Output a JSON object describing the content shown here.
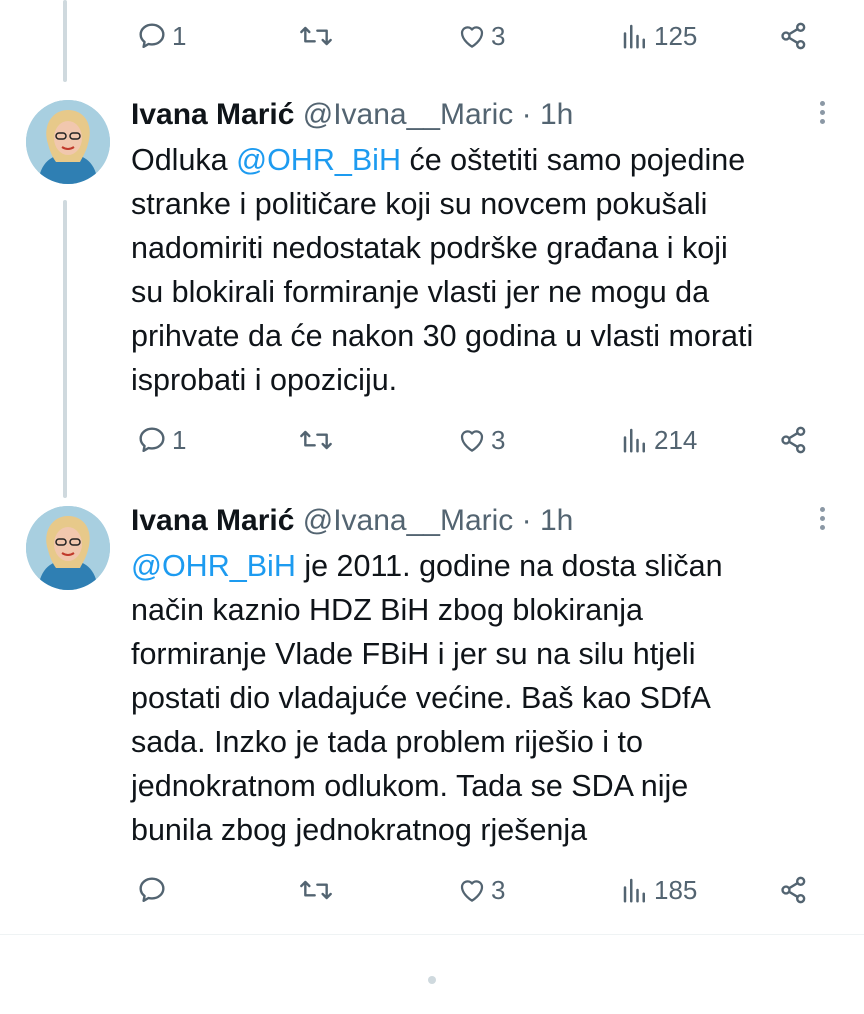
{
  "top_actions": {
    "replies": "1",
    "likes": "3",
    "views": "125"
  },
  "tweets": [
    {
      "name": "Ivana Marić",
      "handle": "@Ivana__Maric",
      "dot": "·",
      "time": "1h",
      "lines": [
        {
          "mention": "",
          "pre": "Odluka ",
          "mention_text": "@OHR_BiH",
          "post": " će oštetiti samo pojedine"
        },
        {
          "pre": "stranke i političare koji su novcem pokušali"
        },
        {
          "pre": "nadomiriti nedostatak podrške građana i koji"
        },
        {
          "pre": "su blokirali formiranje vlasti jer ne mogu da"
        },
        {
          "pre": "prihvate da će nakon 30 godina u vlasti morati"
        },
        {
          "pre": "isprobati i opoziciju."
        }
      ],
      "replies": "1",
      "likes": "3",
      "views": "214"
    },
    {
      "name": "Ivana Marić",
      "handle": "@Ivana__Maric",
      "dot": "·",
      "time": "1h",
      "lines": [
        {
          "mention_text": "@OHR_BiH",
          "post": " je 2011. godine na dosta sličan"
        },
        {
          "pre": "način kaznio HDZ BiH zbog blokiranja"
        },
        {
          "pre": "formiranje Vlade FBiH i jer su na silu htjeli"
        },
        {
          "pre": "postati dio vladajuće većine. Baš kao SDfA"
        },
        {
          "pre": "sada. Inzko je tada problem riješio i to"
        },
        {
          "pre": "jednokratnom odlukom. Tada se SDA nije"
        },
        {
          "pre": "bunila zbog jednokratnog rješenja"
        }
      ],
      "replies": "",
      "likes": "3",
      "views": "185"
    }
  ],
  "icons": {
    "reply": "reply-icon",
    "retweet": "retweet-icon",
    "like": "heart-icon",
    "views": "views-icon",
    "share": "share-icon",
    "more": "more-icon"
  },
  "colors": {
    "mention": "#1d9bf0",
    "muted": "#536471",
    "text": "#0f1419"
  }
}
